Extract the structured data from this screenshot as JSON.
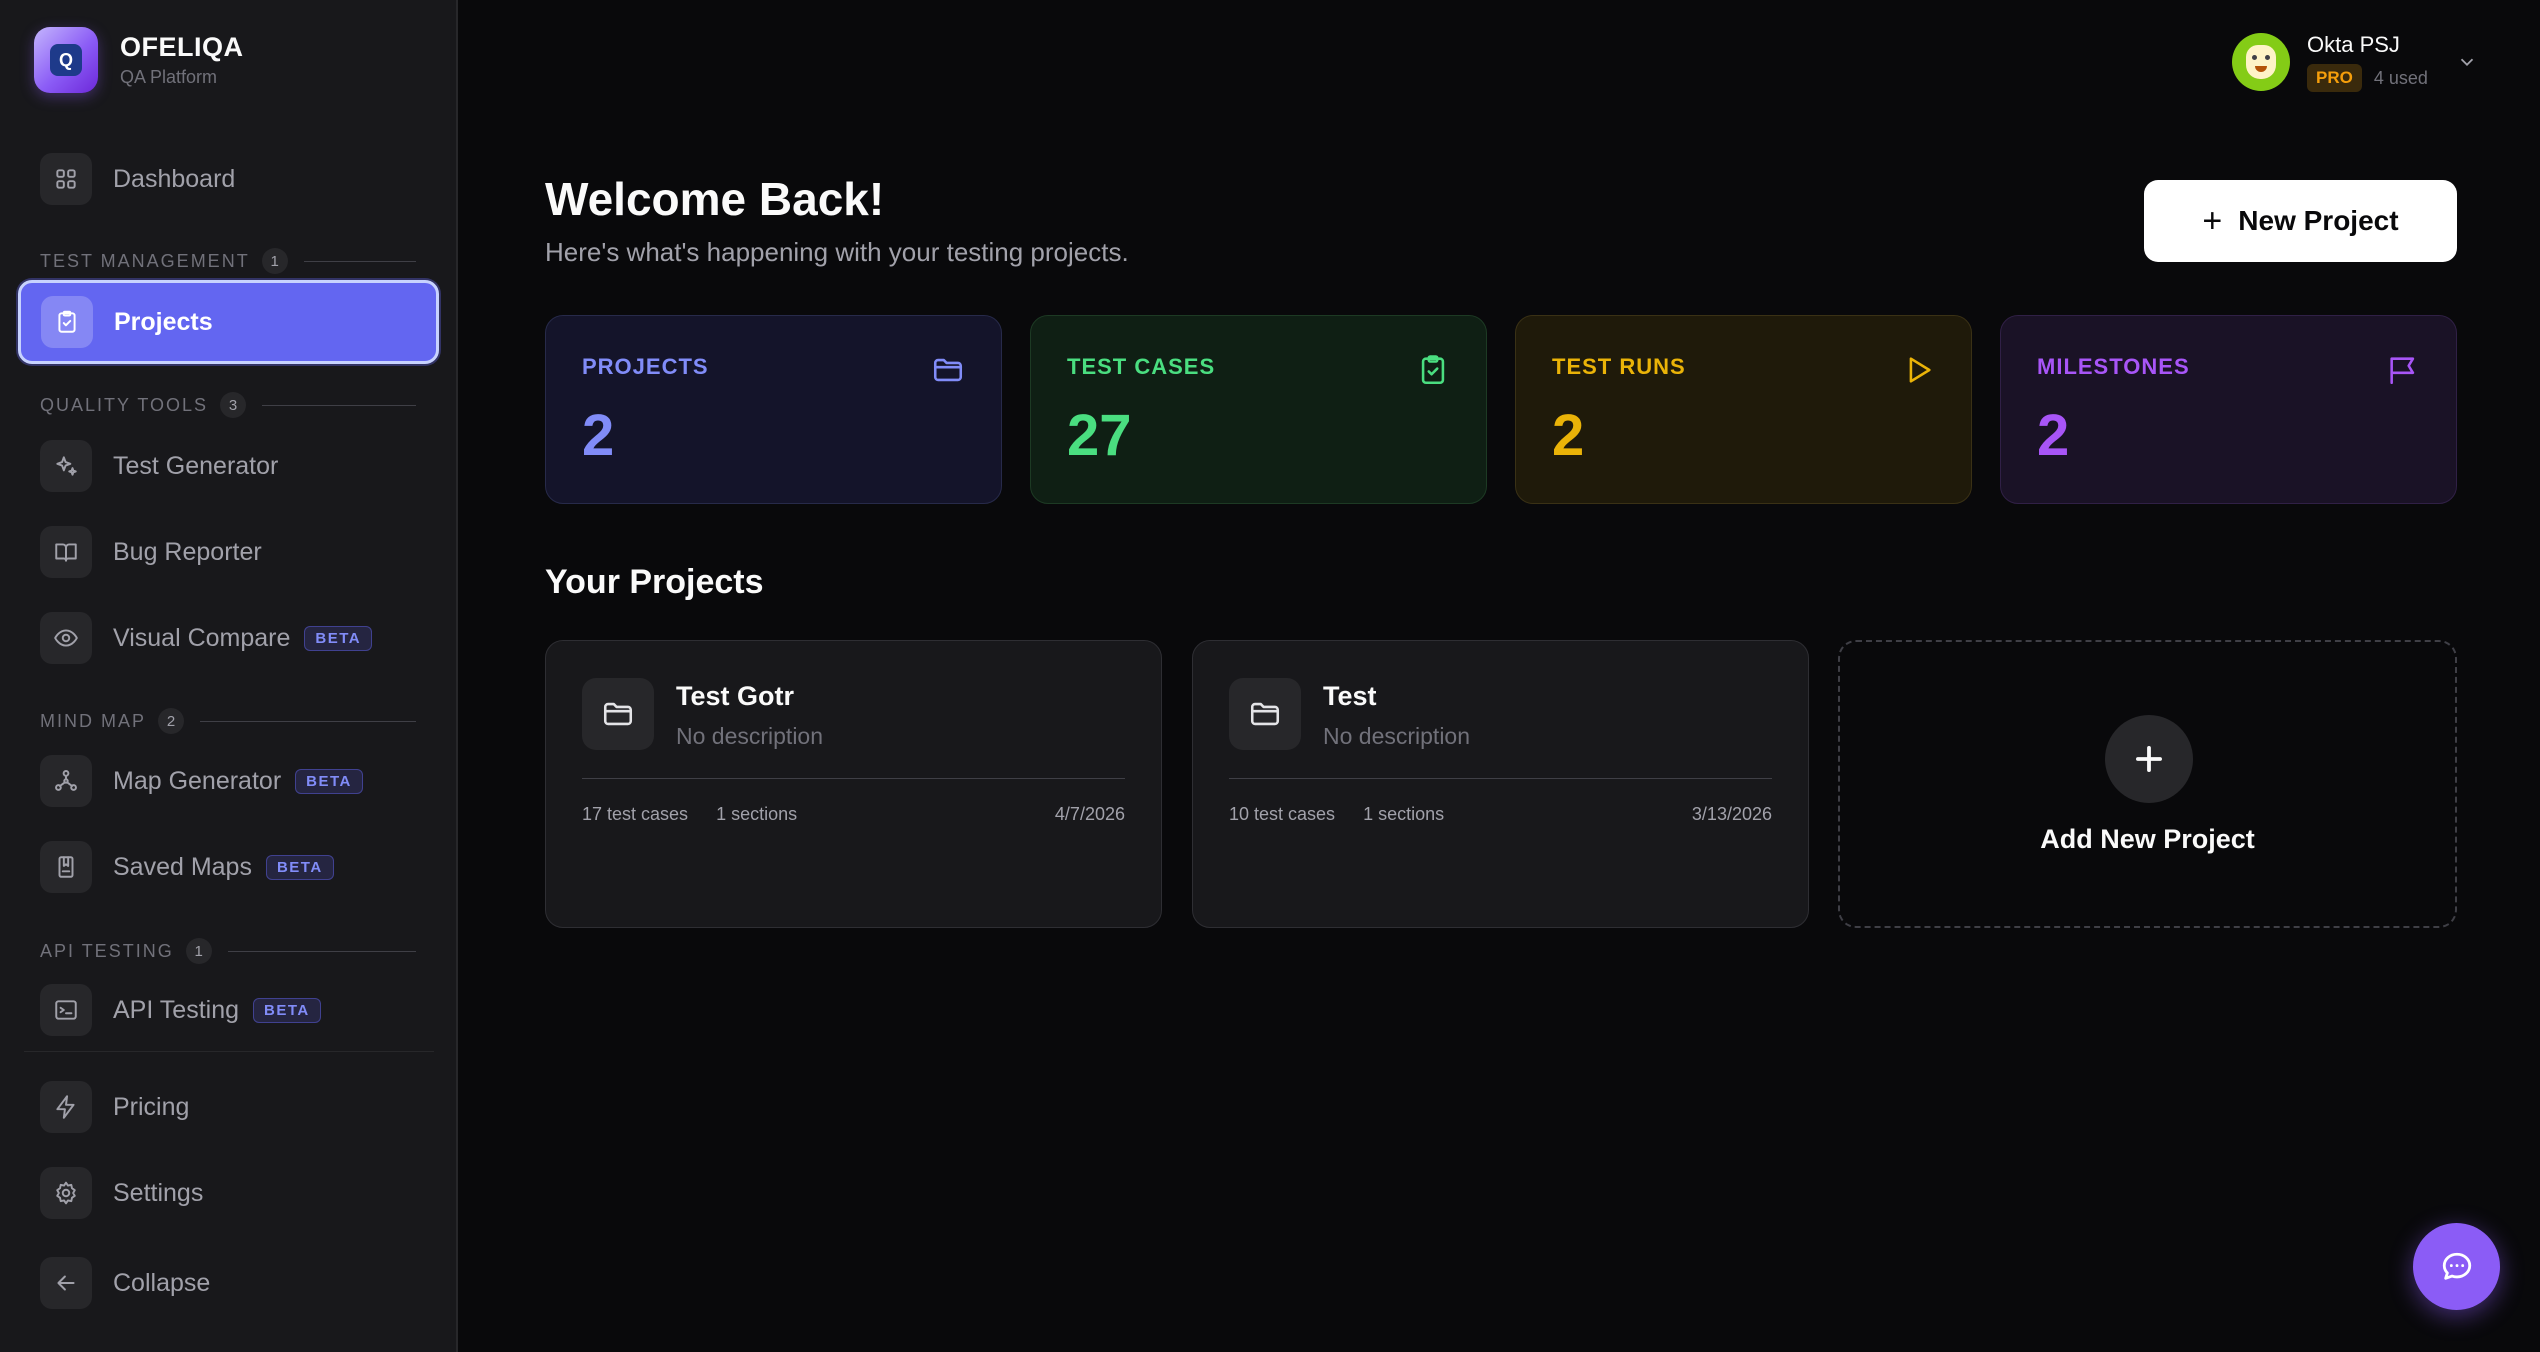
{
  "brand": {
    "name": "OFELIQA",
    "subtitle": "QA Platform",
    "logo_letter": "Q"
  },
  "sidebar": {
    "dashboard": {
      "label": "Dashboard",
      "icon": "grid-icon"
    },
    "sections": {
      "test_management": {
        "title": "TEST MANAGEMENT",
        "count": "1"
      },
      "quality_tools": {
        "title": "QUALITY TOOLS",
        "count": "3"
      },
      "mind_map": {
        "title": "MIND MAP",
        "count": "2"
      },
      "api_testing": {
        "title": "API TESTING",
        "count": "1"
      }
    },
    "items": {
      "projects": {
        "label": "Projects",
        "icon": "clipboard-icon",
        "active": true
      },
      "test_generator": {
        "label": "Test Generator",
        "icon": "sparkles-icon"
      },
      "bug_reporter": {
        "label": "Bug Reporter",
        "icon": "book-icon"
      },
      "visual_compare": {
        "label": "Visual Compare",
        "icon": "eye-icon",
        "badge": "BETA"
      },
      "map_generator": {
        "label": "Map Generator",
        "icon": "nodes-icon",
        "badge": "BETA"
      },
      "saved_maps": {
        "label": "Saved Maps",
        "icon": "bookmark-icon",
        "badge": "BETA"
      },
      "api_testing": {
        "label": "API Testing",
        "icon": "terminal-icon",
        "badge": "BETA"
      },
      "pricing": {
        "label": "Pricing",
        "icon": "bolt-icon"
      },
      "settings": {
        "label": "Settings",
        "icon": "gear-icon"
      },
      "collapse": {
        "label": "Collapse",
        "icon": "arrow-left-icon"
      }
    }
  },
  "user": {
    "name": "Okta PSJ",
    "plan": "PRO",
    "usage": "4 used"
  },
  "header": {
    "title": "Welcome Back!",
    "subtitle": "Here's what's happening with your testing projects.",
    "new_project_label": "New Project"
  },
  "stats": [
    {
      "label": "PROJECTS",
      "value": "2",
      "icon": "folder-icon",
      "color": "#818cf8",
      "bg": "#14142a",
      "border": "#272a4a"
    },
    {
      "label": "TEST CASES",
      "value": "27",
      "icon": "clipboard-check-icon",
      "color": "#4ade80",
      "bg": "#0f1f14",
      "border": "#1d3a24"
    },
    {
      "label": "TEST RUNS",
      "value": "2",
      "icon": "play-icon",
      "color": "#eab308",
      "bg": "#1f1a0a",
      "border": "#3a3115"
    },
    {
      "label": "MILESTONES",
      "value": "2",
      "icon": "flag-icon",
      "color": "#a855f7",
      "bg": "#1a1226",
      "border": "#302046"
    }
  ],
  "projects_section": {
    "title": "Your Projects",
    "projects": [
      {
        "name": "Test Gotr",
        "description": "No description",
        "test_cases": "17 test cases",
        "sections": "1 sections",
        "date": "4/7/2026"
      },
      {
        "name": "Test",
        "description": "No description",
        "test_cases": "10 test cases",
        "sections": "1 sections",
        "date": "3/13/2026"
      }
    ],
    "add_label": "Add New Project"
  },
  "chat": {
    "icon": "chat-icon"
  }
}
